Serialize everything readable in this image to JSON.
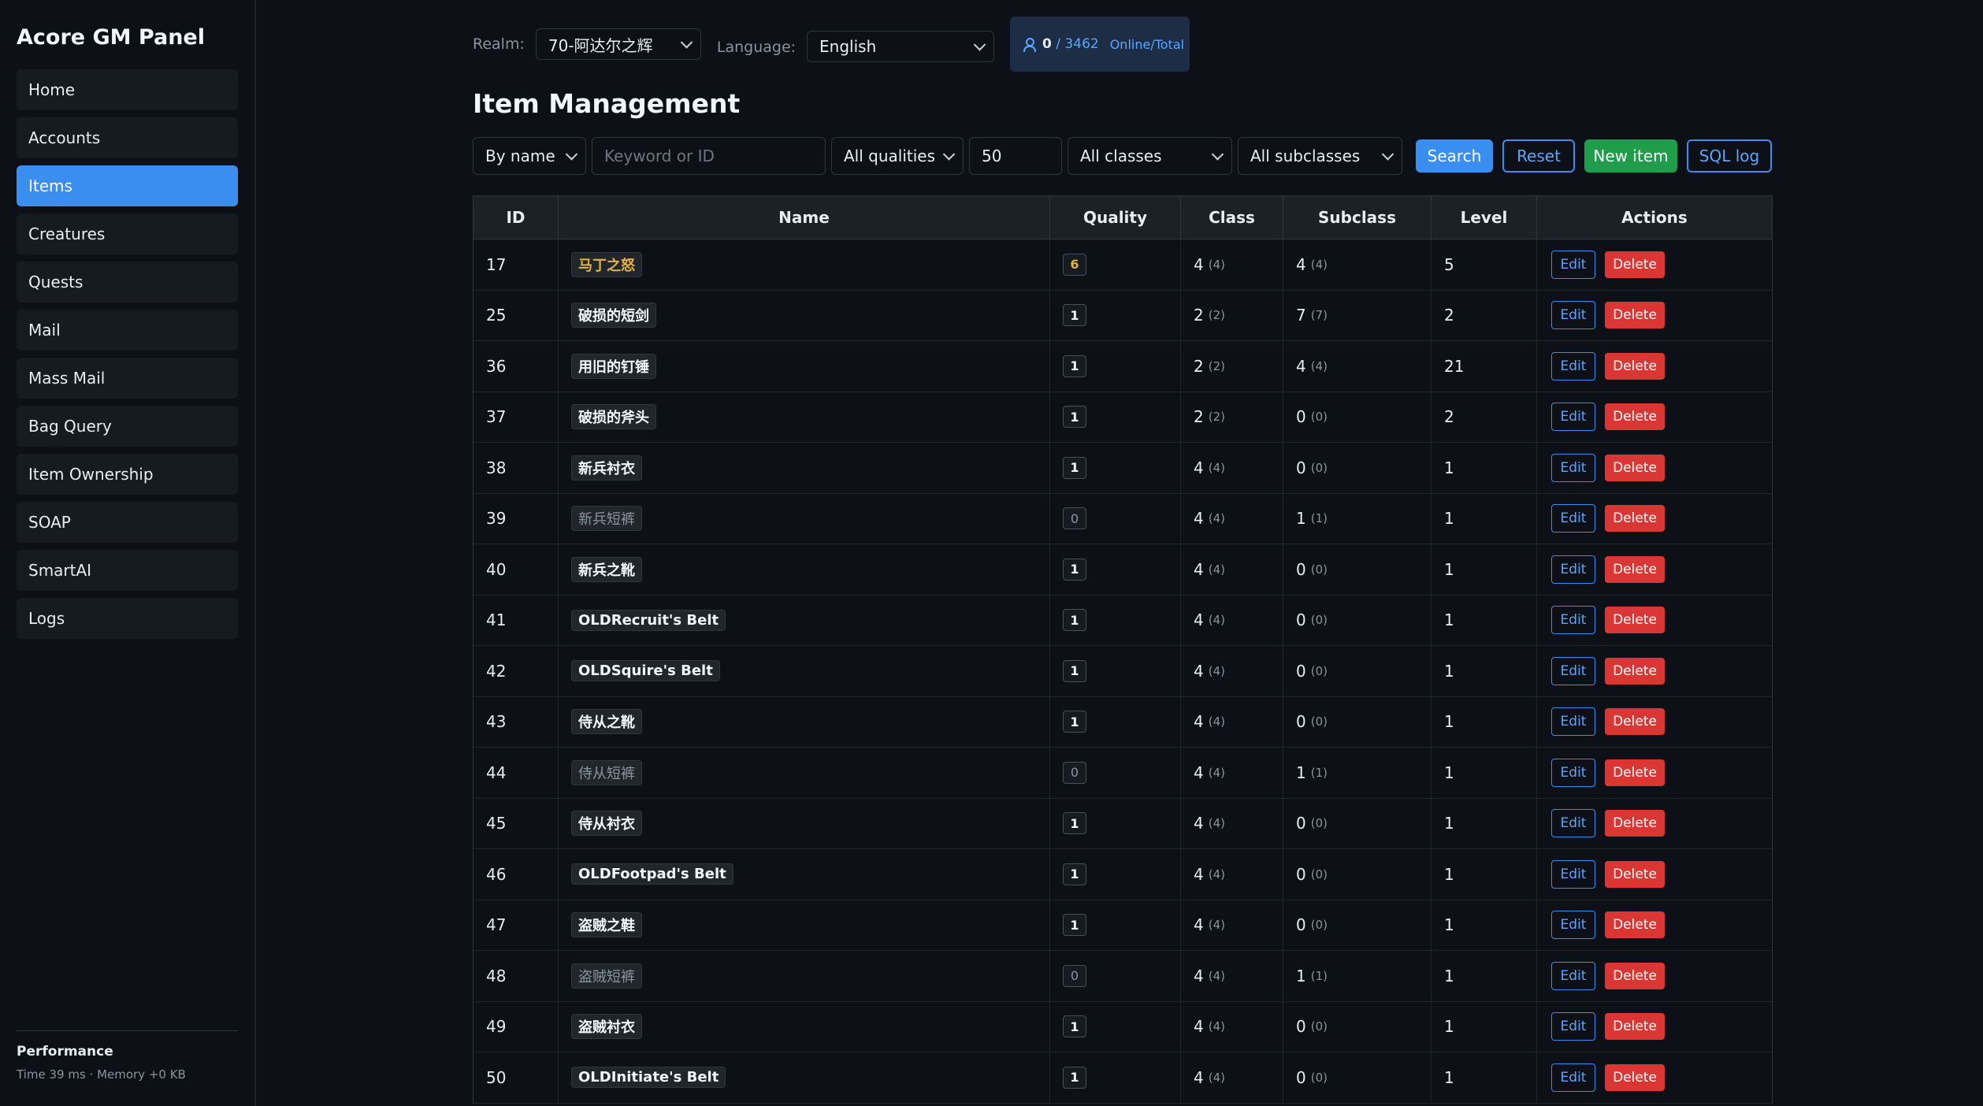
{
  "app": {
    "title": "Acore GM Panel"
  },
  "sidebar": {
    "items": [
      {
        "label": "Home",
        "active": false
      },
      {
        "label": "Accounts",
        "active": false
      },
      {
        "label": "Items",
        "active": true
      },
      {
        "label": "Creatures",
        "active": false
      },
      {
        "label": "Quests",
        "active": false
      },
      {
        "label": "Mail",
        "active": false
      },
      {
        "label": "Mass Mail",
        "active": false
      },
      {
        "label": "Bag Query",
        "active": false
      },
      {
        "label": "Item Ownership",
        "active": false
      },
      {
        "label": "SOAP",
        "active": false
      },
      {
        "label": "SmartAI",
        "active": false
      },
      {
        "label": "Logs",
        "active": false
      }
    ],
    "performance_title": "Performance",
    "performance_text": "Time 39 ms · Memory +0 KB"
  },
  "topbar": {
    "realm_label": "Realm:",
    "realm_value": "70-阿达尔之辉",
    "language_label": "Language:",
    "language_value": "English",
    "online_count": "0",
    "total_count": "3462",
    "online_label": "Online/Total"
  },
  "page": {
    "title": "Item Management"
  },
  "filters": {
    "search_mode": "By name",
    "keyword_placeholder": "Keyword or ID",
    "quality": "All qualities",
    "limit": "50",
    "class": "All classes",
    "subclass": "All subclasses",
    "search_label": "Search",
    "reset_label": "Reset",
    "new_item_label": "New item",
    "sql_log_label": "SQL log"
  },
  "table": {
    "headers": [
      "ID",
      "Name",
      "Quality",
      "Class",
      "Subclass",
      "Level",
      "Actions"
    ],
    "edit_label": "Edit",
    "delete_label": "Delete",
    "rows": [
      {
        "id": "17",
        "name": "马丁之怒",
        "quality": "6",
        "class": "4",
        "class_raw": "(4)",
        "subclass": "4",
        "subclass_raw": "(4)",
        "level": "5"
      },
      {
        "id": "25",
        "name": "破损的短剑",
        "quality": "1",
        "class": "2",
        "class_raw": "(2)",
        "subclass": "7",
        "subclass_raw": "(7)",
        "level": "2"
      },
      {
        "id": "36",
        "name": "用旧的钉锤",
        "quality": "1",
        "class": "2",
        "class_raw": "(2)",
        "subclass": "4",
        "subclass_raw": "(4)",
        "level": "21"
      },
      {
        "id": "37",
        "name": "破损的斧头",
        "quality": "1",
        "class": "2",
        "class_raw": "(2)",
        "subclass": "0",
        "subclass_raw": "(0)",
        "level": "2"
      },
      {
        "id": "38",
        "name": "新兵衬衣",
        "quality": "1",
        "class": "4",
        "class_raw": "(4)",
        "subclass": "0",
        "subclass_raw": "(0)",
        "level": "1"
      },
      {
        "id": "39",
        "name": "新兵短裤",
        "quality": "0",
        "class": "4",
        "class_raw": "(4)",
        "subclass": "1",
        "subclass_raw": "(1)",
        "level": "1"
      },
      {
        "id": "40",
        "name": "新兵之靴",
        "quality": "1",
        "class": "4",
        "class_raw": "(4)",
        "subclass": "0",
        "subclass_raw": "(0)",
        "level": "1"
      },
      {
        "id": "41",
        "name": "OLDRecruit's Belt",
        "quality": "1",
        "class": "4",
        "class_raw": "(4)",
        "subclass": "0",
        "subclass_raw": "(0)",
        "level": "1"
      },
      {
        "id": "42",
        "name": "OLDSquire's Belt",
        "quality": "1",
        "class": "4",
        "class_raw": "(4)",
        "subclass": "0",
        "subclass_raw": "(0)",
        "level": "1"
      },
      {
        "id": "43",
        "name": "侍从之靴",
        "quality": "1",
        "class": "4",
        "class_raw": "(4)",
        "subclass": "0",
        "subclass_raw": "(0)",
        "level": "1"
      },
      {
        "id": "44",
        "name": "侍从短裤",
        "quality": "0",
        "class": "4",
        "class_raw": "(4)",
        "subclass": "1",
        "subclass_raw": "(1)",
        "level": "1"
      },
      {
        "id": "45",
        "name": "侍从衬衣",
        "quality": "1",
        "class": "4",
        "class_raw": "(4)",
        "subclass": "0",
        "subclass_raw": "(0)",
        "level": "1"
      },
      {
        "id": "46",
        "name": "OLDFootpad's Belt",
        "quality": "1",
        "class": "4",
        "class_raw": "(4)",
        "subclass": "0",
        "subclass_raw": "(0)",
        "level": "1"
      },
      {
        "id": "47",
        "name": "盗贼之鞋",
        "quality": "1",
        "class": "4",
        "class_raw": "(4)",
        "subclass": "0",
        "subclass_raw": "(0)",
        "level": "1"
      },
      {
        "id": "48",
        "name": "盗贼短裤",
        "quality": "0",
        "class": "4",
        "class_raw": "(4)",
        "subclass": "1",
        "subclass_raw": "(1)",
        "level": "1"
      },
      {
        "id": "49",
        "name": "盗贼衬衣",
        "quality": "1",
        "class": "4",
        "class_raw": "(4)",
        "subclass": "0",
        "subclass_raw": "(0)",
        "level": "1"
      },
      {
        "id": "50",
        "name": "OLDInitiate's Belt",
        "quality": "1",
        "class": "4",
        "class_raw": "(4)",
        "subclass": "0",
        "subclass_raw": "(0)",
        "level": "1"
      }
    ]
  },
  "colors": {
    "accent": "#3a8ef0",
    "success": "#1f9d4a",
    "danger": "#da3633",
    "legendary": "#e3b341"
  }
}
